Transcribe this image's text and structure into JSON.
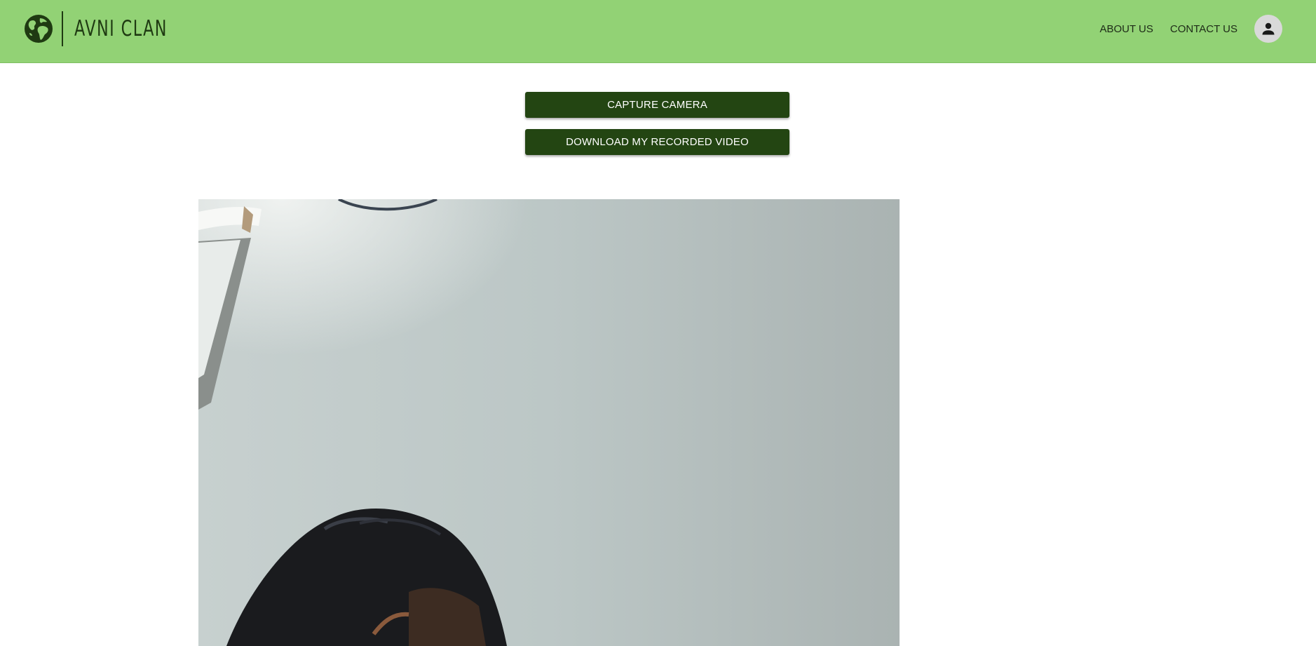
{
  "header": {
    "brand": "AVNI CLAN",
    "logo_icon": "globe-icon",
    "background": "#92d275",
    "nav": [
      {
        "label": "ABOUT US"
      },
      {
        "label": "CONTACT US"
      }
    ],
    "avatar_icon": "person-icon"
  },
  "actions": {
    "capture_label": "CAPTURE CAMERA",
    "download_label": "DOWNLOAD MY RECORDED VIDEO",
    "button_color": "#234512"
  },
  "video": {
    "content": "webcam-feed"
  }
}
